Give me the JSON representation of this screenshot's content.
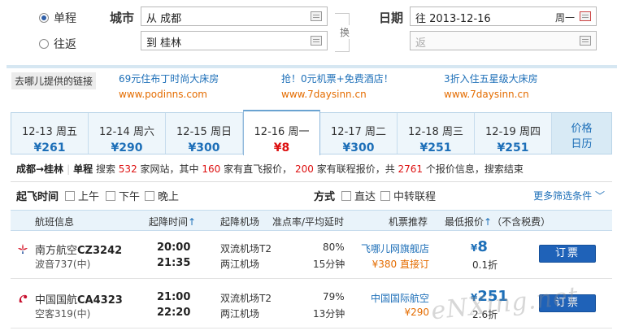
{
  "form": {
    "trip_types": [
      {
        "label": "单程",
        "selected": true
      },
      {
        "label": "往返",
        "selected": false
      }
    ],
    "city_label": "城市",
    "from_value": "从 成都",
    "to_value": "到 桂林",
    "swap_label": "换",
    "date_label": "日期",
    "depart_value": "往 2013-12-16",
    "depart_weekday": "周一",
    "return_placeholder": "返"
  },
  "ads": {
    "label": "去哪儿提供的链接",
    "items": [
      {
        "title": "69元住布丁时尚大床房",
        "url": "www.podinns.com"
      },
      {
        "title": "抢！0元机票+免费酒店！",
        "url": "www.7daysinn.cn"
      },
      {
        "title": "3折入住五星级大床房",
        "url": "www.7daysinn.cn"
      }
    ]
  },
  "date_tabs": [
    {
      "date": "12-13 周五",
      "price": "¥261",
      "active": false
    },
    {
      "date": "12-14 周六",
      "price": "¥290",
      "active": false
    },
    {
      "date": "12-15 周日",
      "price": "¥300",
      "active": false
    },
    {
      "date": "12-16 周一",
      "price": "¥8",
      "active": true
    },
    {
      "date": "12-17 周二",
      "price": "¥300",
      "active": false
    },
    {
      "date": "12-18 周三",
      "price": "¥251",
      "active": false
    },
    {
      "date": "12-19 周四",
      "price": "¥251",
      "active": false
    }
  ],
  "calendar_tab": {
    "line1": "价格",
    "line2": "日历"
  },
  "summary": {
    "route": "成都→桂林",
    "trip": "单程",
    "t1": "搜索",
    "sites": "532",
    "t2": "家网站，其中",
    "direct": "160",
    "t3": "家有直飞报价，",
    "connect": "200",
    "t4": "家有联程报价，共",
    "total": "2761",
    "t5": "个报价信息，搜索结束"
  },
  "filters": {
    "time_title": "起飞时间",
    "time_options": [
      "上午",
      "下午",
      "晚上"
    ],
    "mode_title": "方式",
    "mode_options": [
      "直达",
      "中转联程"
    ],
    "more": "更多筛选条件 ﹀"
  },
  "table_header": {
    "flight": "航班信息",
    "times": "起降时间",
    "times_arrow": "↑",
    "airports": "起降机场",
    "ontime": "准点率/平均延时",
    "recommend": "机票推荐",
    "lowest": "最低报价",
    "lowest_arrow": "↑",
    "tax_note": "（不含税费）"
  },
  "flights": [
    {
      "airline": "南方航空",
      "flight_no": "CZ3242",
      "aircraft": "波音737(中)",
      "dep_time": "20:00",
      "arr_time": "21:35",
      "dep_airport": "双流机场T2",
      "arr_airport": "两江机场",
      "ontime_rate": "80%",
      "avg_delay": "15分钟",
      "agent": "飞哪儿网旗舰店",
      "agent_price": "¥380 直接订",
      "currency": "¥",
      "price": "8",
      "discount": "0.1折",
      "book": "订票",
      "logo_color": "#d7182a"
    },
    {
      "airline": "中国国航",
      "flight_no": "CA4323",
      "aircraft": "空客319(中)",
      "dep_time": "21:00",
      "arr_time": "22:20",
      "dep_airport": "双流机场T2",
      "arr_airport": "两江机场",
      "ontime_rate": "79%",
      "avg_delay": "13分钟",
      "agent": "中国国际航空",
      "agent_price": "¥290",
      "currency": "¥",
      "price": "251",
      "discount": "2.6折",
      "book": "订票",
      "logo_color": "#c8102e"
    }
  ],
  "watermark": "eNXing.net"
}
